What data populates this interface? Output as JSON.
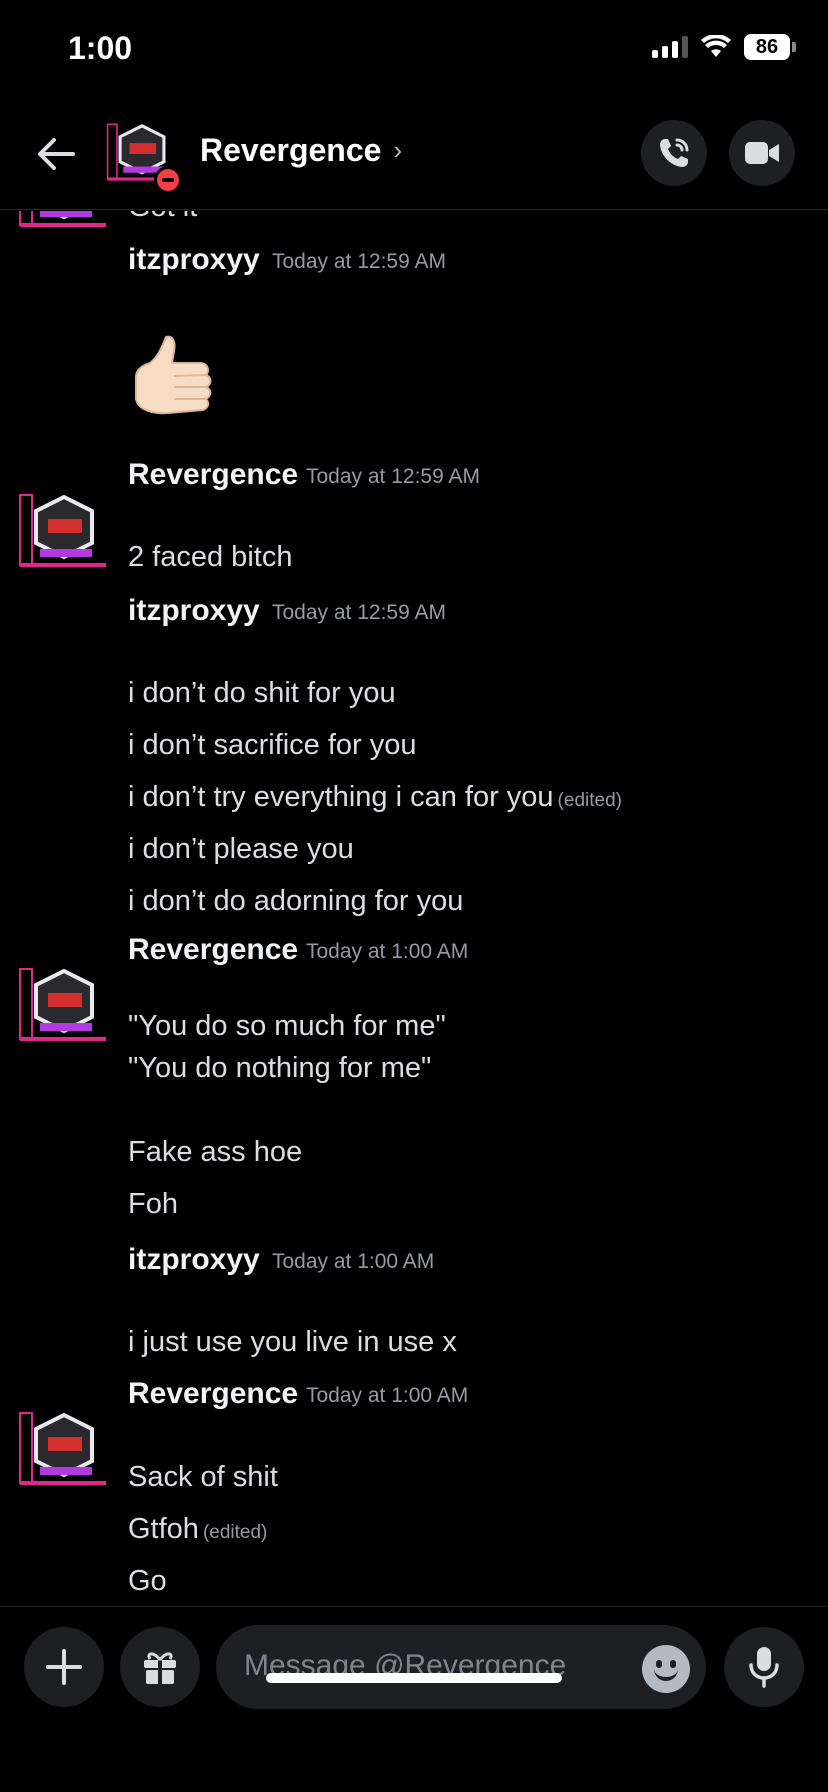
{
  "status_bar": {
    "time": "1:00",
    "battery": "86"
  },
  "header": {
    "title": "Revergence",
    "chevron": "›"
  },
  "messages": {
    "m0": {
      "text": "Got it"
    },
    "m1": {
      "author": "itzproxyy",
      "timestamp": "Today at 12:59 AM",
      "emoji": "thumbs-up"
    },
    "m2": {
      "author": "Revergence",
      "timestamp": "Today at 12:59 AM",
      "lines": [
        "2 faced bitch"
      ]
    },
    "m3": {
      "author": "itzproxyy",
      "timestamp": "Today at 12:59 AM",
      "lines": [
        "i don’t do shit for you",
        "i don’t sacrifice for you",
        "i don’t try everything i can for you",
        "i don’t please you",
        "i don’t do adorning for you"
      ],
      "edited_label": "(edited)"
    },
    "m4": {
      "author": "Revergence",
      "timestamp": "Today at 1:00 AM",
      "lines": [
        "\"You do so much for me\"",
        "\"You do nothing for me\"",
        "Fake ass hoe",
        "Foh"
      ]
    },
    "m5": {
      "author": "itzproxyy",
      "timestamp": "Today at 1:00 AM",
      "lines": [
        "i just use you live in use x"
      ]
    },
    "m6": {
      "author": "Revergence",
      "timestamp": "Today at 1:00 AM",
      "lines": [
        "Sack of shit",
        "Gtfoh",
        "Go"
      ],
      "edited_label": "(edited)"
    }
  },
  "composer": {
    "placeholder": "Message @Revergence"
  },
  "colors": {
    "background": "#000000",
    "surface": "#1e1f22",
    "dnd": "#f23f43",
    "avatar_accent": "#e0288a"
  }
}
